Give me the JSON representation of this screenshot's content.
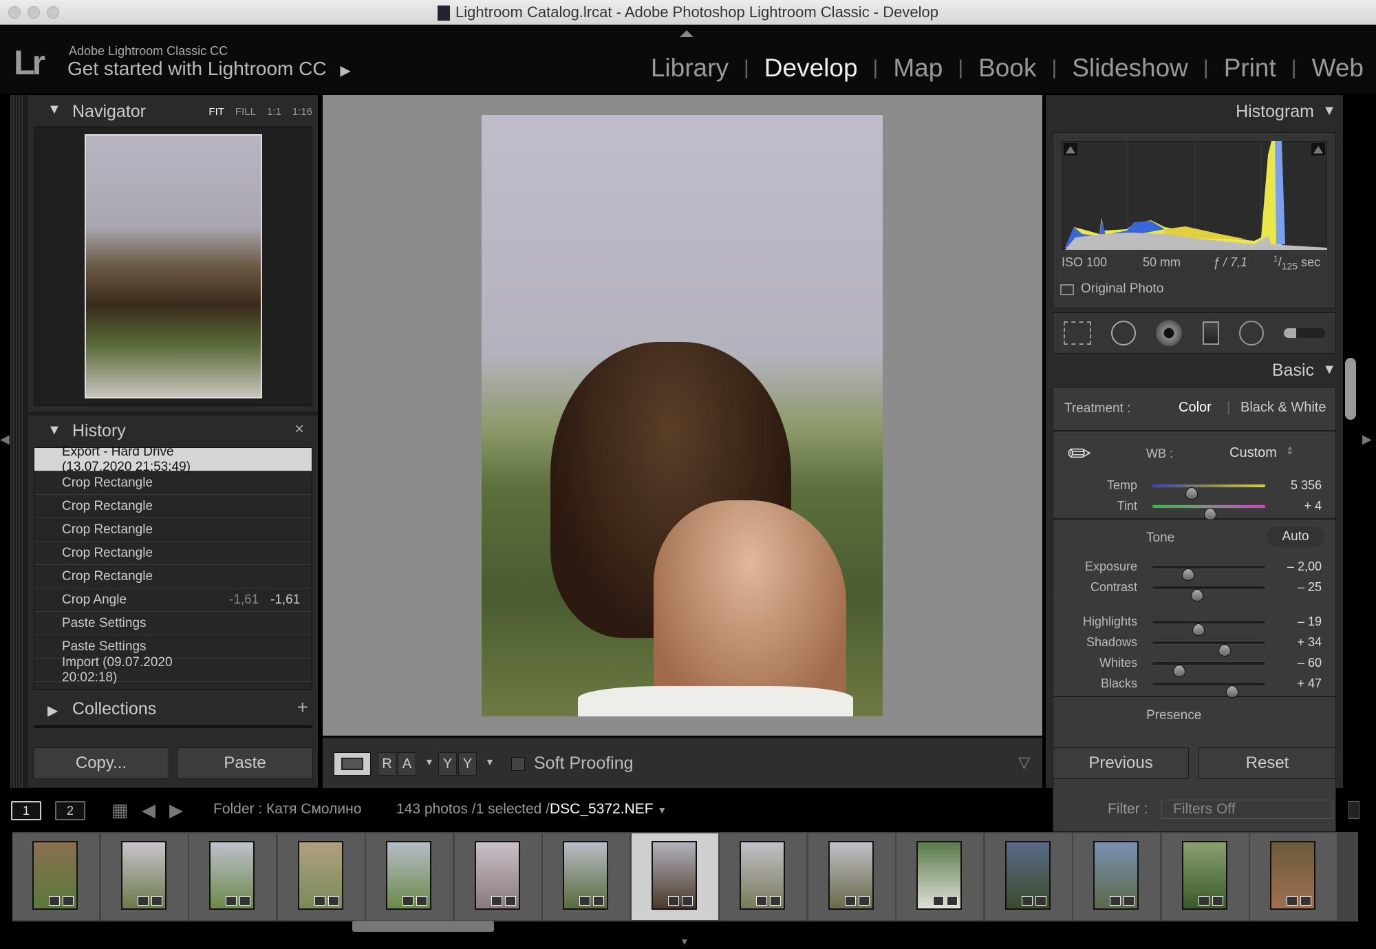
{
  "window": {
    "title": "Lightroom Catalog.lrcat - Adobe Photoshop Lightroom Classic - Develop"
  },
  "identity": {
    "logo": "Lr",
    "line1": "Adobe Lightroom Classic CC",
    "line2": "Get started with Lightroom CC"
  },
  "modules": [
    "Library",
    "Develop",
    "Map",
    "Book",
    "Slideshow",
    "Print",
    "Web"
  ],
  "active_module": "Develop",
  "navigator": {
    "title": "Navigator",
    "zoom_options": [
      "FIT",
      "FILL",
      "1:1",
      "1:16"
    ],
    "selected_zoom": "FIT"
  },
  "history": {
    "title": "History",
    "items": [
      {
        "label": "Export - Hard Drive (13.07.2020 21:53:49)",
        "v1": "",
        "v2": "",
        "selected": true
      },
      {
        "label": "Crop Rectangle",
        "v1": "",
        "v2": ""
      },
      {
        "label": "Crop Rectangle",
        "v1": "",
        "v2": ""
      },
      {
        "label": "Crop Rectangle",
        "v1": "",
        "v2": ""
      },
      {
        "label": "Crop Rectangle",
        "v1": "",
        "v2": ""
      },
      {
        "label": "Crop Rectangle",
        "v1": "",
        "v2": ""
      },
      {
        "label": "Crop Angle",
        "v1": "-1,61",
        "v2": "-1,61"
      },
      {
        "label": "Paste Settings",
        "v1": "",
        "v2": ""
      },
      {
        "label": "Paste Settings",
        "v1": "",
        "v2": ""
      },
      {
        "label": "Import (09.07.2020 20:02:18)",
        "v1": "",
        "v2": ""
      }
    ]
  },
  "collections": {
    "title": "Collections",
    "add": "+"
  },
  "left_buttons": {
    "copy": "Copy...",
    "paste": "Paste"
  },
  "toolbar": {
    "soft_proofing": "Soft Proofing",
    "ra": [
      "R",
      "A"
    ],
    "yy": [
      "Y",
      "Y"
    ]
  },
  "histogram": {
    "title": "Histogram",
    "iso": "ISO 100",
    "focal": "50 mm",
    "aperture": "ƒ / 7,1",
    "shutter_num": "1",
    "shutter_den": "125",
    "shutter_unit": "sec",
    "original_photo": "Original Photo"
  },
  "tools": [
    "crop-overlay",
    "spot-removal",
    "red-eye",
    "graduated-filter",
    "radial-filter",
    "adjustment-brush"
  ],
  "basic": {
    "title": "Basic",
    "treatment_label": "Treatment :",
    "treatment_options": [
      "Color",
      "Black & White"
    ],
    "treatment_selected": "Color",
    "wb_label": "WB :",
    "wb_value": "Custom",
    "tone_label": "Tone",
    "auto": "Auto",
    "presence_label": "Presence",
    "sliders": [
      {
        "label": "Temp",
        "value": "5 356",
        "position": 0.35
      },
      {
        "label": "Tint",
        "value": "+ 4",
        "position": 0.51
      },
      {
        "label": "Exposure",
        "value": "– 2,00",
        "position": 0.32
      },
      {
        "label": "Contrast",
        "value": "– 25",
        "position": 0.395
      },
      {
        "label": "Highlights",
        "value": "– 19",
        "position": 0.41
      },
      {
        "label": "Shadows",
        "value": "+ 34",
        "position": 0.64
      },
      {
        "label": "Whites",
        "value": "– 60",
        "position": 0.24
      },
      {
        "label": "Blacks",
        "value": "+ 47",
        "position": 0.705
      }
    ]
  },
  "right_buttons": {
    "previous": "Previous",
    "reset": "Reset"
  },
  "filmstrip": {
    "view1": "1",
    "view2": "2",
    "folder": "Folder : Катя Смолино",
    "count": "143 photos /1 selected /",
    "filename": "DSC_5372.NEF",
    "filter_label": "Filter :",
    "filter_value": "Filters Off",
    "thumb_count": 15,
    "selected_index": 7
  },
  "colors": {
    "accent": "#eeeeee",
    "panel": "#2a2a2a",
    "canvas": "#8a8a8a"
  }
}
